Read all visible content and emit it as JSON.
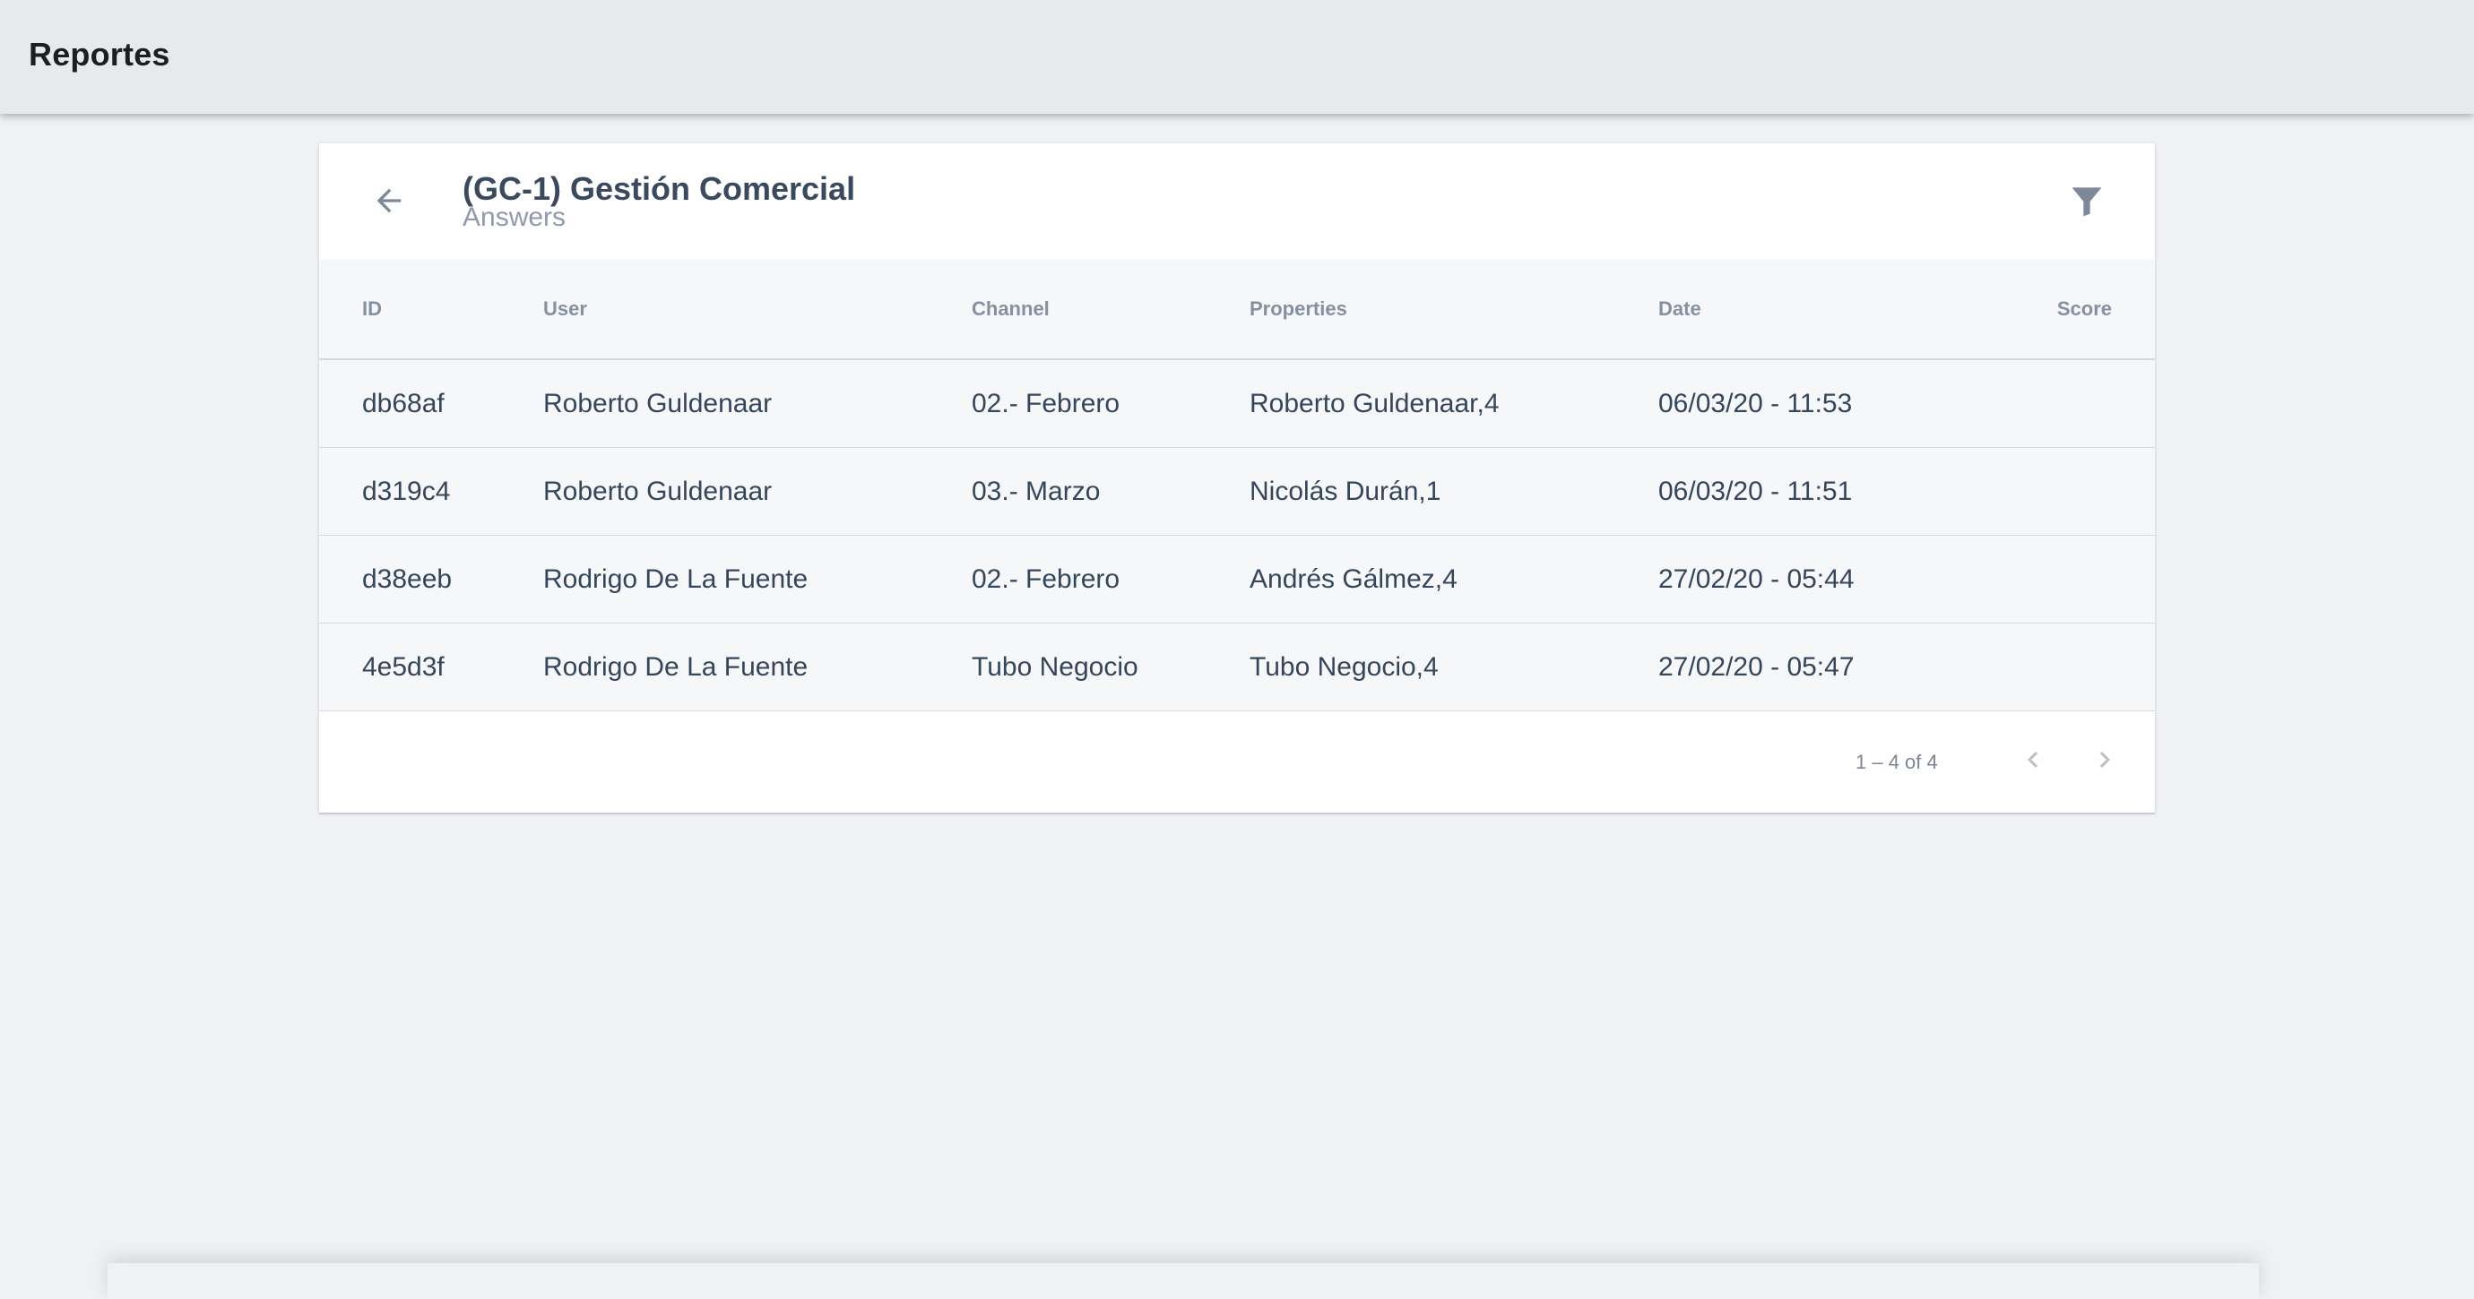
{
  "app": {
    "title": "Reportes"
  },
  "report": {
    "title": "(GC-1) Gestión Comercial",
    "subtitle": "Answers"
  },
  "icons": {
    "back": "arrow-left-icon",
    "filter": "filter-icon",
    "prev": "chevron-left-icon",
    "next": "chevron-right-icon"
  },
  "table": {
    "headers": {
      "id": "ID",
      "user": "User",
      "channel": "Channel",
      "properties": "Properties",
      "date": "Date",
      "score": "Score"
    },
    "rows": [
      {
        "id": "db68af",
        "user": "Roberto Guldenaar",
        "channel": "02.- Febrero",
        "properties": "Roberto Guldenaar,4",
        "date": "06/03/20 - 11:53",
        "score": ""
      },
      {
        "id": "d319c4",
        "user": "Roberto Guldenaar",
        "channel": "03.- Marzo",
        "properties": "Nicolás Durán,1",
        "date": "06/03/20 - 11:51",
        "score": ""
      },
      {
        "id": "d38eeb",
        "user": "Rodrigo De La Fuente",
        "channel": "02.- Febrero",
        "properties": "Andrés Gálmez,4",
        "date": "27/02/20 - 05:44",
        "score": ""
      },
      {
        "id": "4e5d3f",
        "user": "Rodrigo De La Fuente",
        "channel": "Tubo Negocio",
        "properties": "Tubo Negocio,4",
        "date": "27/02/20 - 05:47",
        "score": ""
      }
    ]
  },
  "pagination": {
    "range_label": "1 – 4 of 4"
  },
  "colors": {
    "page_bg": "#eff1f4",
    "topbar_bg": "#e8e9eb",
    "text_primary": "#34465c",
    "icon": "#7d8899"
  }
}
